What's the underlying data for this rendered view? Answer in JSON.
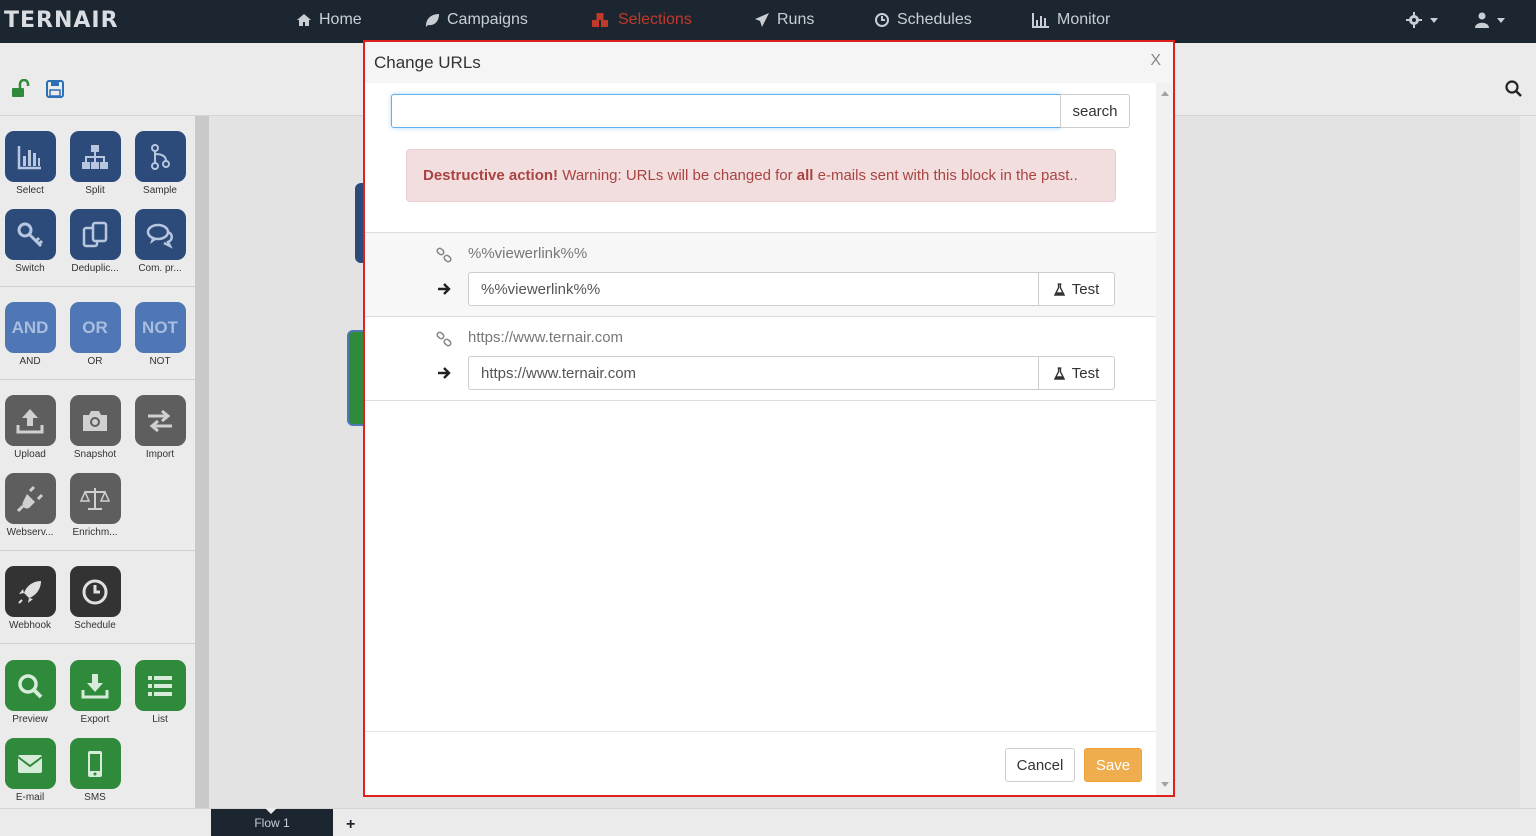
{
  "app": {
    "logo": "TERNAIR"
  },
  "nav": {
    "home": "Home",
    "campaigns": "Campaigns",
    "selections": "Selections",
    "runs": "Runs",
    "schedules": "Schedules",
    "monitor": "Monitor"
  },
  "palette": {
    "select": "Select",
    "split": "Split",
    "sample": "Sample",
    "switch": "Switch",
    "deduplicate": "Deduplic...",
    "compare": "Com. pr...",
    "and_tile": "AND",
    "and": "AND",
    "or_tile": "OR",
    "or": "OR",
    "not_tile": "NOT",
    "not": "NOT",
    "upload": "Upload",
    "snapshot": "Snapshot",
    "import": "Import",
    "webservice": "Webserv...",
    "enrichment": "Enrichm...",
    "webhook": "Webhook",
    "schedule": "Schedule",
    "preview": "Preview",
    "export": "Export",
    "list": "List",
    "email": "E-mail",
    "sms": "SMS"
  },
  "tabs": {
    "flow1": "Flow 1",
    "add": "+"
  },
  "modal": {
    "title": "Change URLs",
    "close": "X",
    "search_value": "",
    "search_button": "search",
    "alert": {
      "strong": "Destructive action!",
      "text_before": " Warning: URLs will be changed for ",
      "emphasis": "all",
      "text_after": " e-mails sent with this block in the past.."
    },
    "rows": [
      {
        "original": "%%viewerlink%%",
        "new_value": "%%viewerlink%%",
        "test": "Test"
      },
      {
        "original": "https://www.ternair.com",
        "new_value": "https://www.ternair.com",
        "test": "Test"
      }
    ],
    "cancel": "Cancel",
    "save": "Save"
  },
  "colors": {
    "nav_bg": "#1c2630",
    "active_nav": "#c0392b",
    "modal_border": "#e0201b",
    "alert_bg": "#f2dede",
    "alert_text": "#a94442",
    "save_btn": "#f0ad4e"
  }
}
